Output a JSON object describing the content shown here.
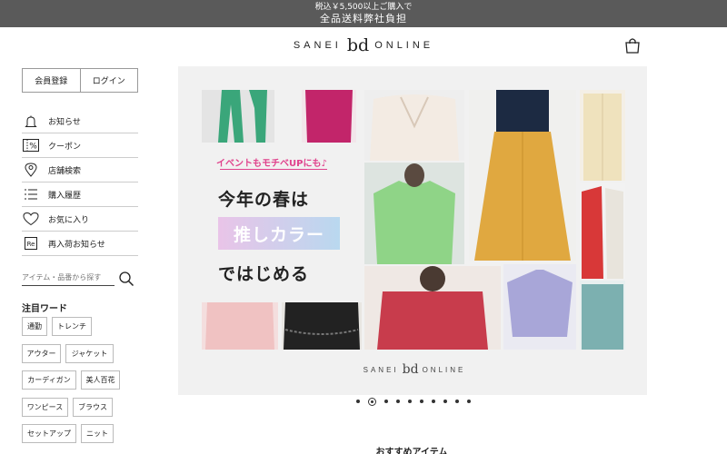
{
  "topbar": {
    "line1": "税込￥5,500以上ご購入で",
    "line2": "全品送料弊社負担"
  },
  "header": {
    "logo_left": "SANEI",
    "logo_mid": "bd",
    "logo_right": "ONLINE",
    "cart_icon": "shopping-bag-icon"
  },
  "auth": {
    "register": "会員登録",
    "login": "ログイン"
  },
  "menu": {
    "items": [
      {
        "label": "お知らせ",
        "icon": "bell-icon"
      },
      {
        "label": "クーポン",
        "icon": "coupon-icon"
      },
      {
        "label": "店舗検索",
        "icon": "location-pin-icon"
      },
      {
        "label": "購入履歴",
        "icon": "list-icon"
      },
      {
        "label": "お気に入り",
        "icon": "heart-icon"
      },
      {
        "label": "再入荷お知らせ",
        "icon": "restock-icon"
      }
    ],
    "coupon_badge": "%",
    "restock_badge": "Re"
  },
  "search": {
    "placeholder": "アイテム・品番から探す",
    "icon": "search-icon"
  },
  "keywords": {
    "title": "注目ワード",
    "tags": [
      "通勤",
      "トレンチ",
      "アウター",
      "ジャケット",
      "カーディガン",
      "美人百花",
      "ワンピース",
      "ブラウス",
      "セットアップ",
      "ニット"
    ]
  },
  "hero": {
    "tagline": "イベントもモチベUPにも♪",
    "line1": "今年の春は",
    "line2": "推しカラー",
    "line3": "ではじめる",
    "logo_left": "SANEI",
    "logo_mid": "bd",
    "logo_right": "ONLINE"
  },
  "carousel": {
    "slide_count": 10,
    "active_index": 1
  },
  "recommend": {
    "title": "おすすめアイテム"
  },
  "colors": {
    "topbar_bg": "#5a5a5a",
    "hero_bg": "#f1f1f1",
    "accent_pink": "#e0428c"
  }
}
